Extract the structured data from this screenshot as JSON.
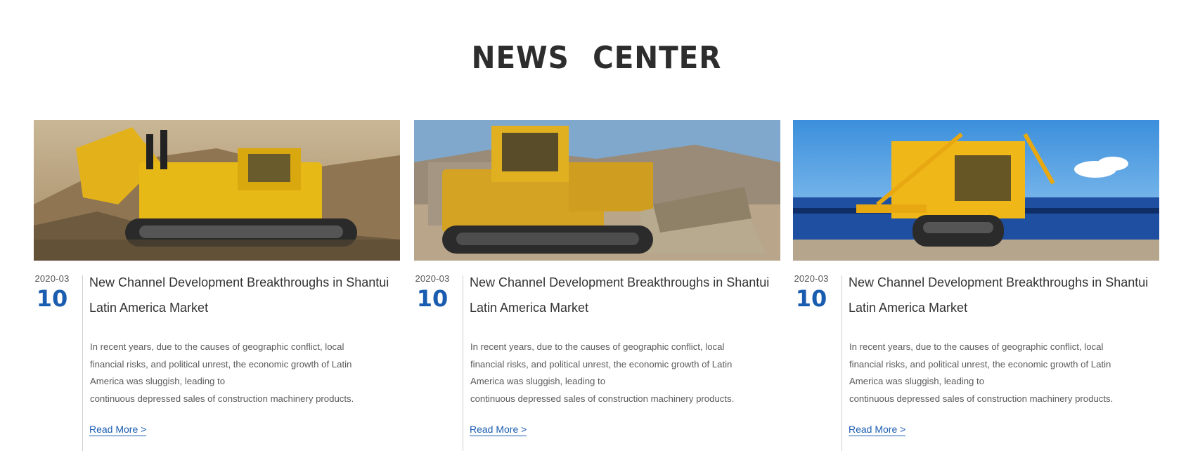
{
  "section": {
    "title": "NEWS CENTER"
  },
  "news": [
    {
      "date_ym": "2020-03",
      "day": "10",
      "title": "New Channel Development Breakthroughs in Shantui Latin America Market",
      "summary_lines": [
        "In recent years, due to the causes of geographic conflict, local",
        "financial risks, and political unrest, the economic growth of Latin",
        "America was sluggish, leading to",
        "continuous depressed sales of construction machinery products."
      ],
      "read_more": "Read More >"
    },
    {
      "date_ym": "2020-03",
      "day": "10",
      "title": "New Channel Development Breakthroughs in Shantui Latin America Market",
      "summary_lines": [
        "In recent years, due to the causes of geographic conflict, local",
        "financial risks, and political unrest, the economic growth of Latin",
        "America was sluggish, leading to",
        "continuous depressed sales of construction machinery products."
      ],
      "read_more": "Read More >"
    },
    {
      "date_ym": "2020-03",
      "day": "10",
      "title": "New Channel Development Breakthroughs in Shantui Latin America Market",
      "summary_lines": [
        "In recent years, due to the causes of geographic conflict, local",
        "financial risks, and political unrest, the economic growth of Latin",
        "America was sluggish, leading to",
        "continuous depressed sales of construction machinery products."
      ],
      "read_more": "Read More >"
    }
  ],
  "images": [
    "bulldozer-photo",
    "bulldozer-photo",
    "bulldozer-photo"
  ],
  "colors": {
    "accent": "#1a5cb0",
    "title": "#2d2d2d",
    "text": "#333333",
    "muted": "#5a5a5a"
  }
}
